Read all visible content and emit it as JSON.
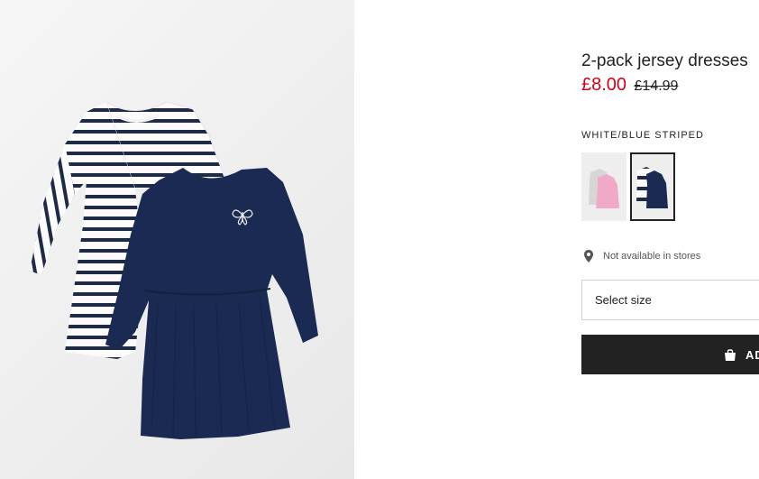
{
  "product": {
    "title": "2-pack jersey dresses",
    "price_sale": "£8.00",
    "price_original": "£14.99",
    "color_name": "WHITE/BLUE STRIPED",
    "availability": "Not available in stores",
    "size_placeholder": "Select size",
    "add_button_label": "AD"
  },
  "swatches": [
    {
      "colors": [
        "#dcdcdc",
        "#f1a9c8"
      ],
      "selected": false
    },
    {
      "colors": [
        "#ffffff",
        "#1b2a52"
      ],
      "selected": true
    }
  ],
  "colors": {
    "sale_price": "#d0021b",
    "button_bg": "#222222",
    "dress_navy": "#1b2a52",
    "stripe_navy": "#1f2a44"
  },
  "icons": {
    "pin": "location-pin-icon",
    "bag": "shopping-bag-icon"
  }
}
